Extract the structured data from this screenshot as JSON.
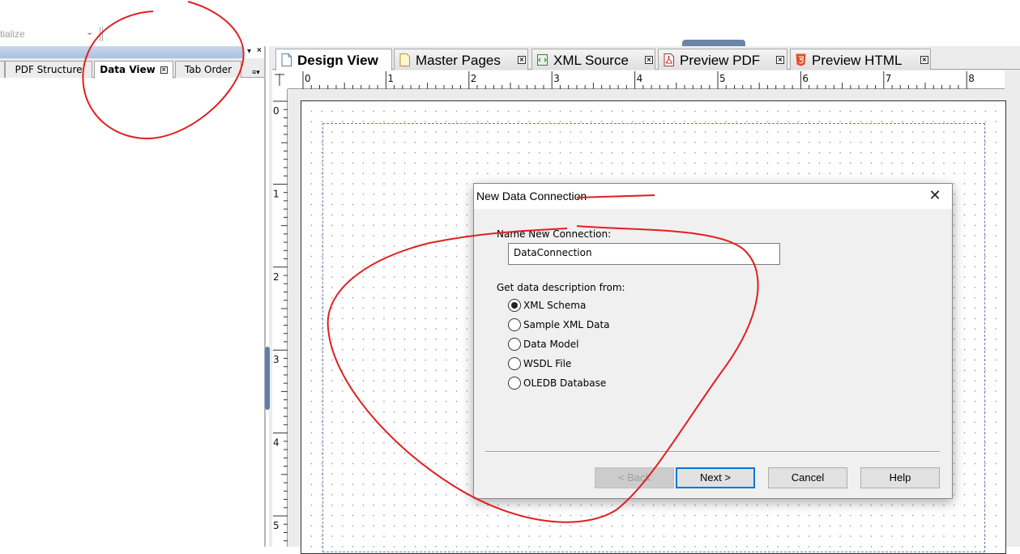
{
  "toolbar": {
    "event_value": "tialize"
  },
  "left_panel": {
    "tabs": [
      {
        "label": "PDF Structure"
      },
      {
        "label": "Data View"
      },
      {
        "label": "Tab Order"
      }
    ]
  },
  "doc_tabs": [
    {
      "label": "Design View"
    },
    {
      "label": "Master Pages"
    },
    {
      "label": "XML Source"
    },
    {
      "label": "Preview PDF"
    },
    {
      "label": "Preview HTML"
    }
  ],
  "ruler": {
    "h_labels": [
      "0",
      "1",
      "2",
      "3",
      "4",
      "5",
      "6",
      "7",
      "8"
    ],
    "v_labels": [
      "0",
      "1",
      "2",
      "3",
      "4",
      "5"
    ]
  },
  "dialog": {
    "title": "New Data Connection",
    "name_label": "Name New Connection:",
    "name_value": "DataConnection",
    "source_label": "Get data description from:",
    "options": [
      "XML Schema",
      "Sample XML Data",
      "Data Model",
      "WSDL File",
      "OLEDB Database"
    ],
    "selected_option": "XML Schema",
    "buttons": {
      "back": "< Back",
      "next": "Next >",
      "cancel": "Cancel",
      "help": "Help"
    }
  },
  "colors": {
    "annotation": "#e02020",
    "accent": "#0078d7",
    "palette_title": "#a9c2de"
  }
}
